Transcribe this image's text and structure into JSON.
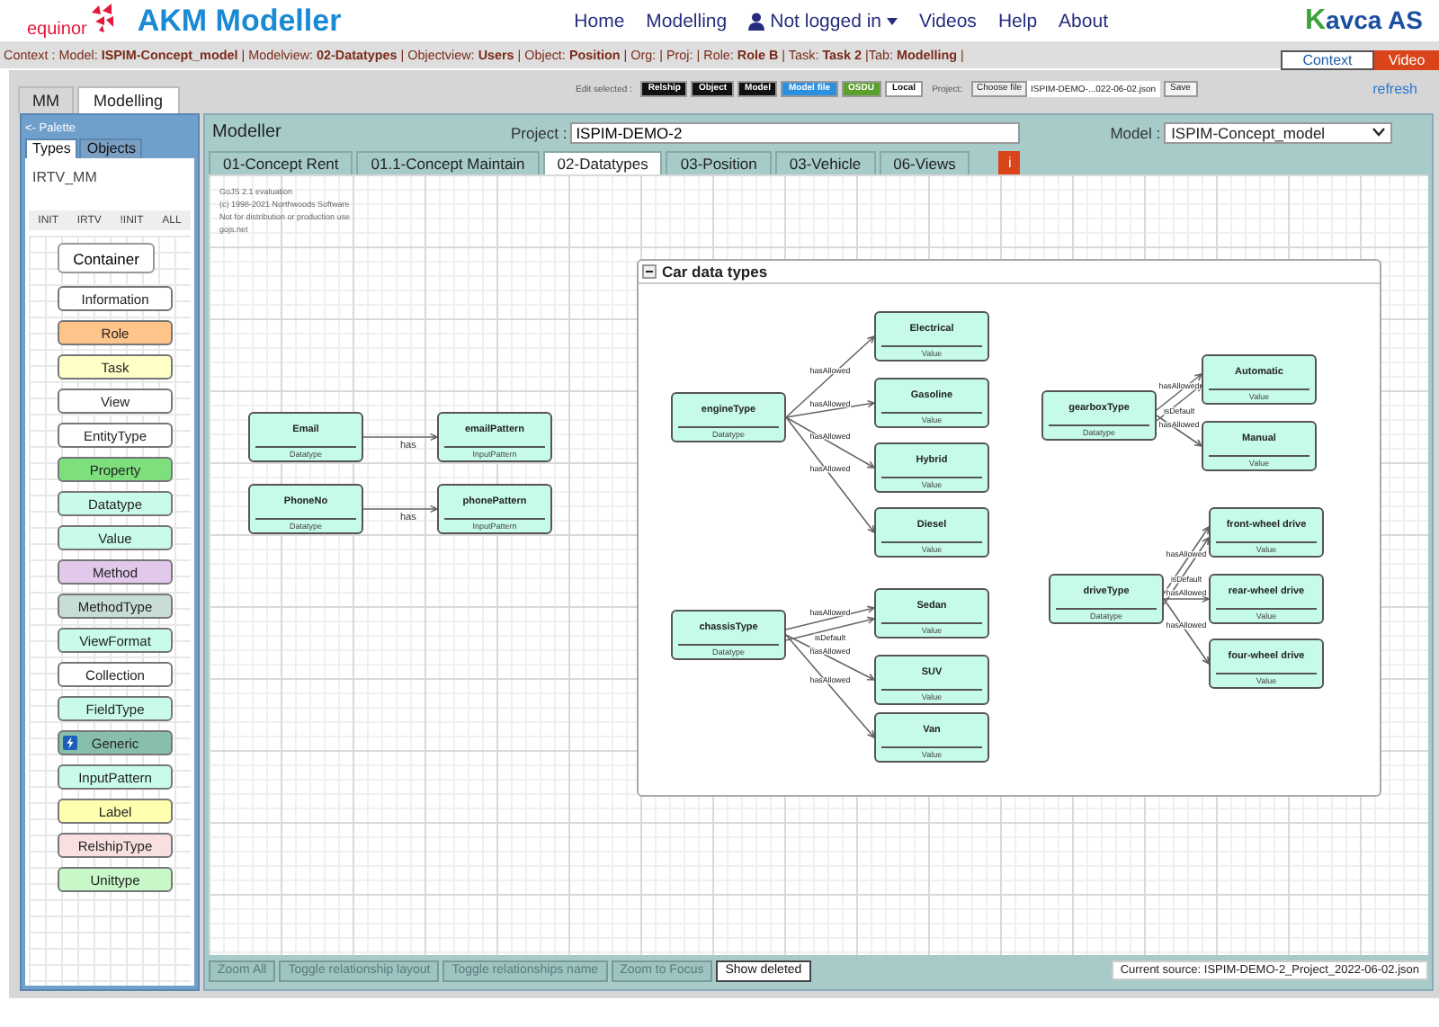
{
  "header": {
    "logo_text": "equinor",
    "title": "AKM Modeller",
    "nav": [
      {
        "label": "Home",
        "kind": "link"
      },
      {
        "label": "Modelling",
        "kind": "link"
      },
      {
        "label": "Not logged in",
        "kind": "user"
      },
      {
        "label": "Videos",
        "kind": "link"
      },
      {
        "label": "Help",
        "kind": "link"
      },
      {
        "label": "About",
        "kind": "link"
      }
    ],
    "brand": "Kavca AS"
  },
  "context": {
    "text": "Context : Model: **ISPIM-Concept_model** | Modelview: **02-Datatypes** | Objectview: **Users** | Object: **Position** | Org: | Proj: | Role: **Role B** | Task: **Task 2** |Tab: **Modelling** |",
    "buttons": [
      {
        "label": "Context",
        "kind": "plain"
      },
      {
        "label": "Video",
        "kind": "accent"
      }
    ]
  },
  "top_tabs": [
    {
      "label": "MM",
      "selected": false
    },
    {
      "label": "Modelling",
      "selected": true
    }
  ],
  "toolbar": {
    "caption": "Edit selected :",
    "buttons": [
      {
        "label": "Relship",
        "kind": "dark"
      },
      {
        "label": "Object",
        "kind": "dark"
      },
      {
        "label": "Model",
        "kind": "dark"
      },
      {
        "label": "Model file",
        "kind": "blue"
      },
      {
        "label": "OSDU",
        "kind": "green"
      },
      {
        "label": "Local",
        "kind": "light"
      }
    ],
    "project_label": "Project:",
    "file_button": "Choose file",
    "file_name": "ISPIM-DEMO-...022-06-02.json",
    "save": "Save",
    "refresh": "refresh"
  },
  "palette": {
    "title": "<- Palette",
    "tabs": [
      {
        "label": "Types",
        "selected": true
      },
      {
        "label": "Objects",
        "selected": false
      }
    ],
    "metamodel": "IRTV_MM",
    "filters": [
      "INIT",
      "IRTV",
      "!INIT",
      "ALL"
    ],
    "container": "Container",
    "items": [
      {
        "label": "Information",
        "color": "#ffffff",
        "kind": "plain"
      },
      {
        "label": "Role",
        "color": "#ffc48a",
        "kind": "plain"
      },
      {
        "label": "Task",
        "color": "#ffffc8",
        "kind": "plain"
      },
      {
        "label": "View",
        "color": "#ffffff",
        "kind": "plain"
      },
      {
        "label": "EntityType",
        "color": "#ffffff",
        "kind": "plain"
      },
      {
        "label": "Property",
        "color": "#7de07d",
        "kind": "plain"
      },
      {
        "label": "Datatype",
        "color": "#c8fbe8",
        "kind": "plain"
      },
      {
        "label": "Value",
        "color": "#c8fbe8",
        "kind": "plain"
      },
      {
        "label": "Method",
        "color": "#e2c8ea",
        "kind": "plain"
      },
      {
        "label": "MethodType",
        "color": "#c8dcd8",
        "kind": "plain"
      },
      {
        "label": "ViewFormat",
        "color": "#c8fbe8",
        "kind": "plain"
      },
      {
        "label": "Collection",
        "color": "#ffffff",
        "kind": "plain"
      },
      {
        "label": "FieldType",
        "color": "#c8fbe8",
        "kind": "plain"
      },
      {
        "label": "Generic",
        "color": "#88bfac",
        "kind": "icon"
      },
      {
        "label": "InputPattern",
        "color": "#c8fbe8",
        "kind": "plain"
      },
      {
        "label": "Label",
        "color": "#ffffb0",
        "kind": "plain"
      },
      {
        "label": "RelshipType",
        "color": "#f8e0e0",
        "kind": "plain"
      },
      {
        "label": "Unittype",
        "color": "#c8f8c8",
        "kind": "plain"
      }
    ]
  },
  "modeller": {
    "title": "Modeller",
    "project_label": "Project :",
    "project": "ISPIM-DEMO-2",
    "model_label": "Model :",
    "model": "ISPIM-Concept_model",
    "tabs": [
      {
        "label": "01-Concept Rent",
        "selected": false
      },
      {
        "label": "01.1-Concept Maintain",
        "selected": false
      },
      {
        "label": "02-Datatypes",
        "selected": true
      },
      {
        "label": "03-Position",
        "selected": false
      },
      {
        "label": "03-Vehicle",
        "selected": false
      },
      {
        "label": "06-Views",
        "selected": false
      }
    ],
    "info_button": "i"
  },
  "diagram": {
    "watermark": [
      "GoJS 2.1 evaluation",
      "(c) 1998-2021 Northwoods Software",
      "Not for distribution or production use",
      "gojs.net"
    ],
    "nodes": [
      {
        "name": "Email",
        "type": "Datatype"
      },
      {
        "name": "emailPattern",
        "type": "InputPattern"
      },
      {
        "name": "PhoneNo",
        "type": "Datatype"
      },
      {
        "name": "phonePattern",
        "type": "InputPattern"
      }
    ],
    "links": [
      {
        "label": "has"
      },
      {
        "label": "has"
      }
    ],
    "group": {
      "title": "Car data types",
      "nodes": [
        {
          "name": "engineType",
          "type": "Datatype"
        },
        {
          "name": "Electrical",
          "type": "Value"
        },
        {
          "name": "Gasoline",
          "type": "Value"
        },
        {
          "name": "Hybrid",
          "type": "Value"
        },
        {
          "name": "Diesel",
          "type": "Value"
        },
        {
          "name": "gearboxType",
          "type": "Datatype"
        },
        {
          "name": "Automatic",
          "type": "Value"
        },
        {
          "name": "Manual",
          "type": "Value"
        },
        {
          "name": "driveType",
          "type": "Datatype"
        },
        {
          "name": "front-wheel drive",
          "type": "Value"
        },
        {
          "name": "rear-wheel drive",
          "type": "Value"
        },
        {
          "name": "four-wheel drive",
          "type": "Value"
        },
        {
          "name": "chassisType",
          "type": "Datatype"
        },
        {
          "name": "Sedan",
          "type": "Value"
        },
        {
          "name": "SUV",
          "type": "Value"
        },
        {
          "name": "Van",
          "type": "Value"
        }
      ],
      "links": [
        {
          "label": "hasAllowed"
        },
        {
          "label": "hasAllowed"
        },
        {
          "label": "hasAllowed"
        },
        {
          "label": "hasAllowed"
        },
        {
          "label": "hasAllowed"
        },
        {
          "label": "isDefault"
        },
        {
          "label": "hasAllowed"
        },
        {
          "label": "hasAllowed"
        },
        {
          "label": "isDefault"
        },
        {
          "label": "hasAllowed"
        },
        {
          "label": "hasAllowed"
        },
        {
          "label": "hasAllowed"
        },
        {
          "label": "isDefault"
        },
        {
          "label": "hasAllowed"
        },
        {
          "label": "hasAllowed"
        }
      ]
    }
  },
  "bottom": {
    "buttons": [
      {
        "label": "Zoom All",
        "disabled": true
      },
      {
        "label": "Toggle relationship layout",
        "disabled": true
      },
      {
        "label": "Toggle relationships name",
        "disabled": true
      },
      {
        "label": "Zoom to Focus",
        "disabled": true
      },
      {
        "label": "Show deleted",
        "disabled": false
      }
    ],
    "source": "Current source: ISPIM-DEMO-2_Project_2022-06-02.json"
  }
}
